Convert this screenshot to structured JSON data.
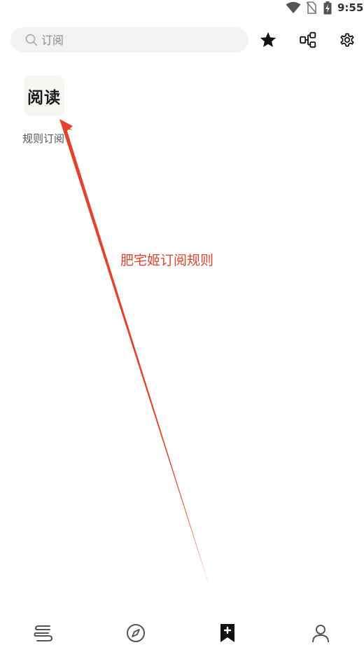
{
  "status_bar": {
    "time": "9:55",
    "icons": [
      "wifi-icon",
      "no-sim-icon",
      "battery-charging-icon"
    ]
  },
  "search": {
    "placeholder": "订阅",
    "value": ""
  },
  "toolbar": {
    "buttons": [
      "star-icon",
      "rule-group-icon",
      "settings-gear-icon"
    ]
  },
  "subscriptions": [
    {
      "icon_text": "阅读",
      "label": "规则订阅"
    }
  ],
  "annotation": {
    "text": "肥宅姬订阅规则",
    "color": "#e5432e"
  },
  "bottom_nav": {
    "items": [
      "bookshelf-icon",
      "discover-compass-icon",
      "subscription-bookmark-icon",
      "my-profile-icon"
    ],
    "active": "subscription-bookmark-icon"
  }
}
